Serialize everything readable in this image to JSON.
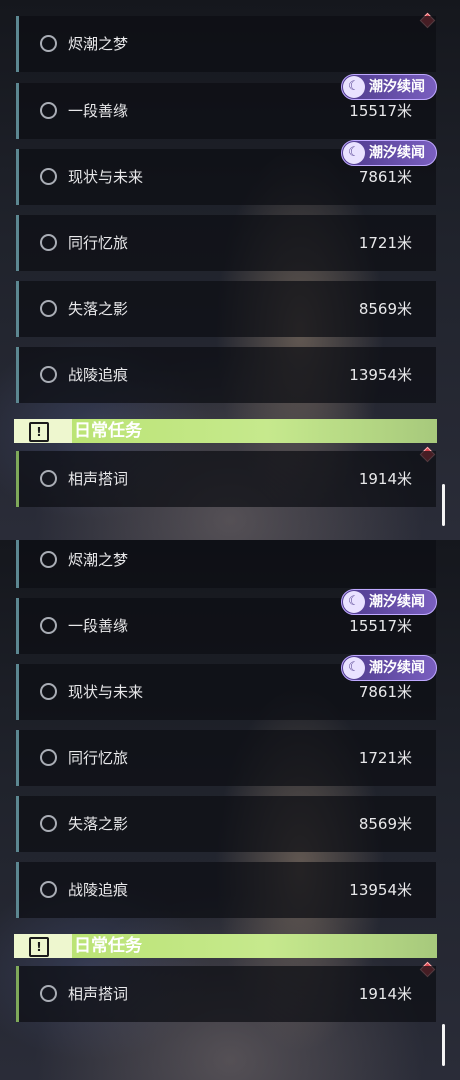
{
  "quest_lists": [
    {
      "entries": [
        {
          "name": "烬潮之梦",
          "distance": ""
        },
        {
          "name": "一段善缘",
          "distance": "15517米",
          "badge": "潮汐续闻"
        },
        {
          "name": "现状与未来",
          "distance": "7861米",
          "badge": "潮汐续闻"
        },
        {
          "name": "同行忆旅",
          "distance": "1721米"
        },
        {
          "name": "失落之影",
          "distance": "8569米"
        },
        {
          "name": "战陵追痕",
          "distance": "13954米"
        }
      ],
      "daily_section": {
        "title": "日常任务",
        "entries": [
          {
            "name": "相声搭词",
            "distance": "1914米"
          }
        ]
      }
    },
    {
      "entries": [
        {
          "name": "烬潮之梦",
          "distance": ""
        },
        {
          "name": "一段善缘",
          "distance": "15517米",
          "badge": "潮汐续闻"
        },
        {
          "name": "现状与未来",
          "distance": "7861米",
          "badge": "潮汐续闻"
        },
        {
          "name": "同行忆旅",
          "distance": "1721米"
        },
        {
          "name": "失落之影",
          "distance": "8569米"
        },
        {
          "name": "战陵追痕",
          "distance": "13954米"
        }
      ],
      "daily_section": {
        "title": "日常任务",
        "entries": [
          {
            "name": "相声搭词",
            "distance": "1914米"
          }
        ]
      }
    }
  ],
  "icons": {
    "untracked": "circle-outline-icon",
    "badge_logo": "tide-crescent-icon",
    "alert": "red-diamond-icon",
    "daily": "exclamation-box-icon"
  },
  "colors": {
    "quest_accent": "#5c8791",
    "daily_accent": "#7fa95a",
    "daily_header": "#b8e26e",
    "badge": "#6a4fb0",
    "alert": "#d9474f"
  }
}
